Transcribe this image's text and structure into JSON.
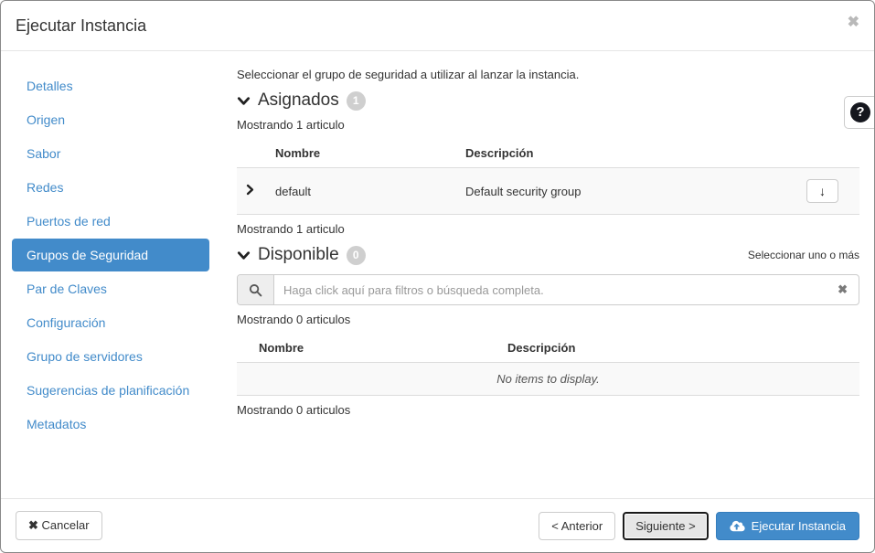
{
  "dialog": {
    "title": "Ejecutar Instancia",
    "close_icon": "✖"
  },
  "help": {
    "icon": "?"
  },
  "colors": {
    "accent": "#428bca",
    "active_nav_bg": "#428bca",
    "row_bg": "#f9f9f9"
  },
  "sidebar": {
    "items": [
      {
        "label": "Detalles",
        "active": false
      },
      {
        "label": "Origen",
        "active": false
      },
      {
        "label": "Sabor",
        "active": false
      },
      {
        "label": "Redes",
        "active": false
      },
      {
        "label": "Puertos de red",
        "active": false
      },
      {
        "label": "Grupos de Seguridad",
        "active": true
      },
      {
        "label": "Par de Claves",
        "active": false
      },
      {
        "label": "Configuración",
        "active": false
      },
      {
        "label": "Grupo de servidores",
        "active": false
      },
      {
        "label": "Sugerencias de planificación",
        "active": false
      },
      {
        "label": "Metadatos",
        "active": false
      }
    ]
  },
  "content": {
    "intro": "Seleccionar el grupo de seguridad a utilizar al lanzar la instancia.",
    "assigned": {
      "title": "Asignados",
      "badge": "1",
      "count_top": "Mostrando 1 articulo",
      "count_bottom": "Mostrando 1 articulo",
      "columns": [
        "Nombre",
        "Descripción"
      ],
      "rows": [
        {
          "name": "default",
          "description": "Default security group"
        }
      ]
    },
    "available": {
      "title": "Disponible",
      "badge": "0",
      "hint": "Seleccionar uno o más",
      "search_placeholder": "Haga click aquí para filtros o búsqueda completa.",
      "count_top": "Mostrando 0 articulos",
      "count_bottom": "Mostrando 0 articulos",
      "columns": [
        "Nombre",
        "Descripción"
      ],
      "empty": "No items to display."
    }
  },
  "icons": {
    "arrow_down": "↓",
    "cancel_x": "✖",
    "clear_x": "✖",
    "chevron_left": "<",
    "chevron_right": ">"
  },
  "footer": {
    "cancel": "Cancelar",
    "back": "Anterior",
    "next": "Siguiente",
    "launch": "Ejecutar Instancia"
  }
}
